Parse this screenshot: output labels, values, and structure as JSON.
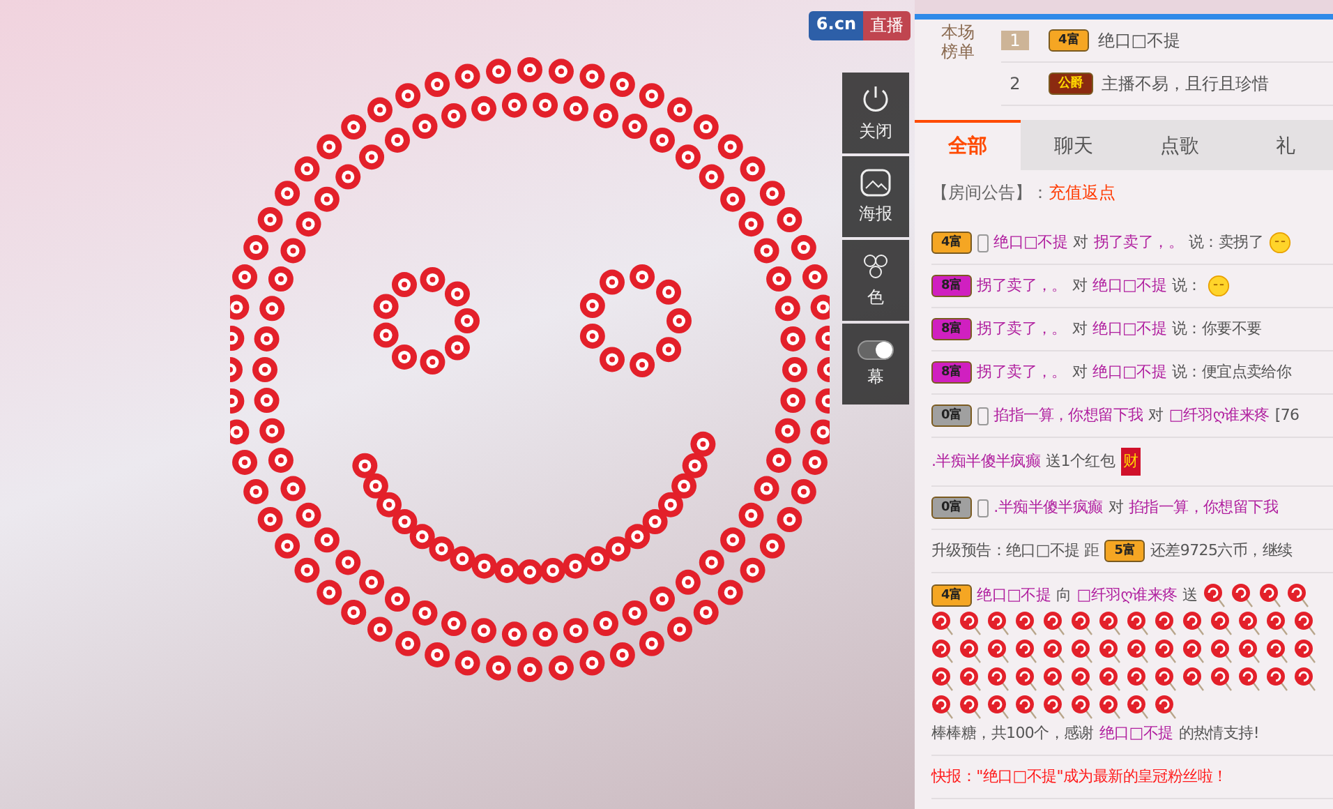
{
  "player": {
    "logo": {
      "site": "6.cn",
      "label": "直播"
    },
    "side_buttons": [
      {
        "label": "关闭"
      },
      {
        "label": "海报"
      },
      {
        "label": "色"
      },
      {
        "label": "幕",
        "on": true
      }
    ]
  },
  "ranking": {
    "title": "本场榜单",
    "rows": [
      {
        "rank": "1",
        "badge": {
          "label": "4富",
          "color": "#f5a623"
        },
        "name": "绝口□不提"
      },
      {
        "rank": "2",
        "badge": {
          "label": "公爵",
          "color": "#8b2a10"
        },
        "name": "主播不易，且行且珍惜"
      }
    ]
  },
  "tabs": [
    {
      "label": "全部",
      "selected": true
    },
    {
      "label": "聊天",
      "selected": false
    },
    {
      "label": "点歌",
      "selected": false
    },
    {
      "label": "礼",
      "selected": false
    }
  ],
  "announcement": {
    "label": "【房间公告】：",
    "text": "充值返点"
  },
  "messages": [
    {
      "parts": [
        {
          "kind": "badge",
          "label": "4富",
          "color": "#f5a623"
        },
        {
          "kind": "phone"
        },
        {
          "kind": "user",
          "text": "绝口□不提"
        },
        {
          "kind": "text",
          "text": "对"
        },
        {
          "kind": "user",
          "text": "拐了卖了，。"
        },
        {
          "kind": "text",
          "text": "说：卖拐了"
        },
        {
          "kind": "emoji"
        }
      ]
    },
    {
      "parts": [
        {
          "kind": "badge",
          "label": "8富",
          "color": "#d020c0"
        },
        {
          "kind": "user",
          "text": "拐了卖了，。"
        },
        {
          "kind": "text",
          "text": "对"
        },
        {
          "kind": "user",
          "text": "绝口□不提"
        },
        {
          "kind": "text",
          "text": "说："
        },
        {
          "kind": "emoji"
        }
      ]
    },
    {
      "parts": [
        {
          "kind": "badge",
          "label": "8富",
          "color": "#d020c0"
        },
        {
          "kind": "user",
          "text": "拐了卖了，。"
        },
        {
          "kind": "text",
          "text": "对"
        },
        {
          "kind": "user",
          "text": "绝口□不提"
        },
        {
          "kind": "text",
          "text": "说：你要不要"
        }
      ]
    },
    {
      "parts": [
        {
          "kind": "badge",
          "label": "8富",
          "color": "#d020c0"
        },
        {
          "kind": "user",
          "text": "拐了卖了，。"
        },
        {
          "kind": "text",
          "text": "对"
        },
        {
          "kind": "user",
          "text": "绝口□不提"
        },
        {
          "kind": "text",
          "text": "说：便宜点卖给你"
        }
      ]
    },
    {
      "parts": [
        {
          "kind": "badge",
          "label": "0富",
          "color": "#a0a0a0"
        },
        {
          "kind": "phone"
        },
        {
          "kind": "user",
          "text": "掐指一算，你想留下我"
        },
        {
          "kind": "text",
          "text": "对"
        },
        {
          "kind": "user",
          "text": "□纤羽ღ谁来疼"
        },
        {
          "kind": "text",
          "text": "[76"
        }
      ]
    },
    {
      "parts": [
        {
          "kind": "user",
          "text": ".半痴半傻半疯癫"
        },
        {
          "kind": "text",
          "text": "送1个红包"
        },
        {
          "kind": "redpacket",
          "label": "财"
        }
      ]
    },
    {
      "parts": [
        {
          "kind": "badge",
          "label": "0富",
          "color": "#a0a0a0"
        },
        {
          "kind": "phone"
        },
        {
          "kind": "user",
          "text": ".半痴半傻半疯癫"
        },
        {
          "kind": "text",
          "text": "对"
        },
        {
          "kind": "user",
          "text": "掐指一算，你想留下我"
        }
      ]
    },
    {
      "parts": [
        {
          "kind": "text",
          "text": "升级预告：绝口□不提 距"
        },
        {
          "kind": "badge",
          "label": "5富",
          "color": "#f5a623"
        },
        {
          "kind": "text",
          "text": "还差9725六币，继续"
        }
      ]
    },
    {
      "parts": [
        {
          "kind": "badge",
          "label": "4富",
          "color": "#f5a623"
        },
        {
          "kind": "user",
          "text": "绝口□不提"
        },
        {
          "kind": "text",
          "text": "向"
        },
        {
          "kind": "user",
          "text": "□纤羽ღ谁来疼"
        },
        {
          "kind": "text",
          "text": "送"
        },
        {
          "kind": "lollipops"
        },
        {
          "kind": "text",
          "text": "棒棒糖，共100个，感谢"
        },
        {
          "kind": "user",
          "text": "绝口□不提"
        },
        {
          "kind": "text",
          "text": "的热情支持!"
        }
      ]
    },
    {
      "parts": [
        {
          "kind": "alert",
          "text": "快报：\"绝口□不提\"成为最新的皇冠粉丝啦！"
        }
      ]
    }
  ]
}
